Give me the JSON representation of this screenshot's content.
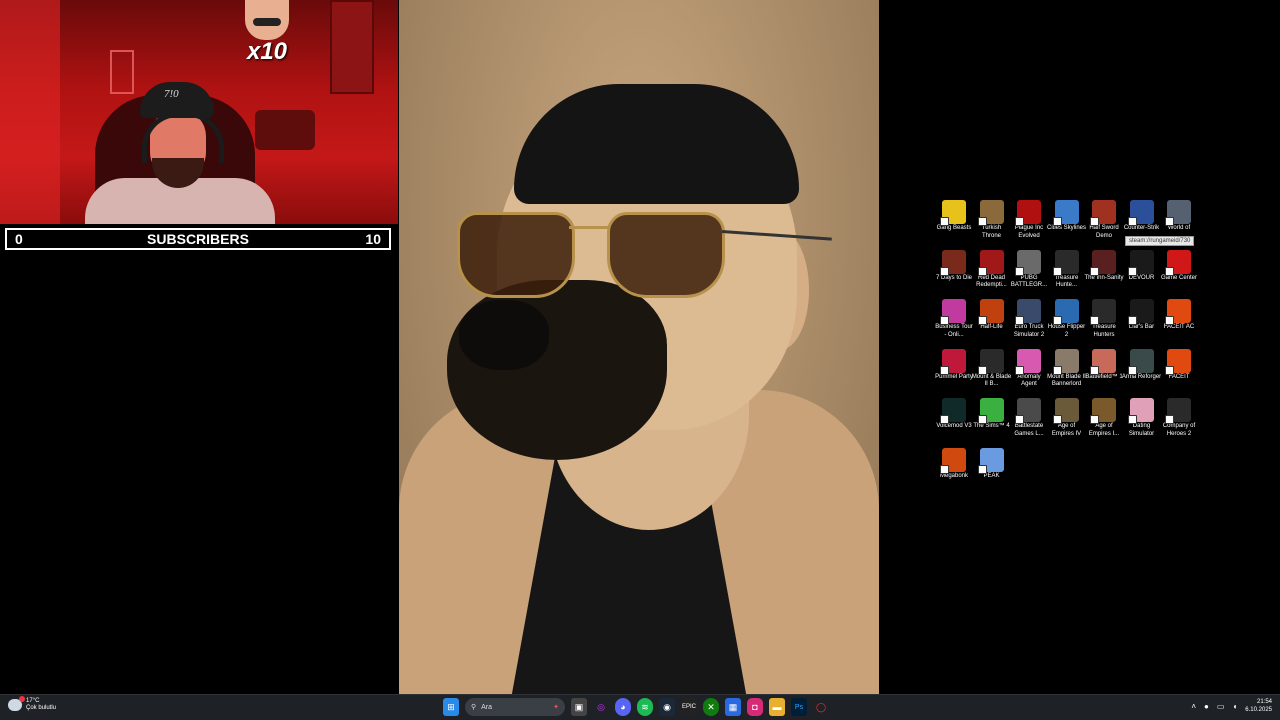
{
  "webcam": {
    "cap_text": "7!0",
    "badge_text": "x10"
  },
  "subscribers": {
    "current": "0",
    "label": "SUBSCRIBERS",
    "goal": "10"
  },
  "desktop_icons": [
    {
      "label": "Gang Beasts",
      "color": "#e6c21a"
    },
    {
      "label": "Turkish Throne",
      "color": "#8a6a3a"
    },
    {
      "label": "Plague Inc Evolved",
      "color": "#b01010"
    },
    {
      "label": "Cities Skylines",
      "color": "#3a7ac8"
    },
    {
      "label": "Half Sword Demo",
      "color": "#a03020"
    },
    {
      "label": "Counter-Strik",
      "color": "#2c4f9a"
    },
    {
      "label": "World of",
      "color": "#556070"
    },
    {
      "label": "7 Days to Die",
      "color": "#7a2a1a"
    },
    {
      "label": "Red Dead Redempti...",
      "color": "#a01818"
    },
    {
      "label": "PUBG BATTLEGR...",
      "color": "#6a6a6a"
    },
    {
      "label": "Treasure Hunte...",
      "color": "#2a2a2a"
    },
    {
      "label": "The Inn-Sanity",
      "color": "#5a2020"
    },
    {
      "label": "DEVOUR",
      "color": "#1a1a1a"
    },
    {
      "label": "Game Center",
      "color": "#d01818"
    },
    {
      "label": "Business Tour - Onli...",
      "color": "#c03aa0"
    },
    {
      "label": "Half-Life",
      "color": "#c04010"
    },
    {
      "label": "Euro Truck Simulator 2",
      "color": "#3a4a6a"
    },
    {
      "label": "House Flipper 2",
      "color": "#2a6ab0"
    },
    {
      "label": "Treasure Hunters",
      "color": "#2a2a2a"
    },
    {
      "label": "Liar's Bar",
      "color": "#1a1a1a"
    },
    {
      "label": "FACEIT AC",
      "color": "#e04a10"
    },
    {
      "label": "Pummel Party",
      "color": "#c0183a"
    },
    {
      "label": "Mount & Blade II B...",
      "color": "#2a2a2a"
    },
    {
      "label": "Anomaly Agent",
      "color": "#d85ab0"
    },
    {
      "label": "Mount Blade II Bannerlord",
      "color": "#8a7a6a"
    },
    {
      "label": "Battlefield™ 1",
      "color": "#c86a5a"
    },
    {
      "label": "Arma Reforger",
      "color": "#3a4a4a"
    },
    {
      "label": "FACEIT",
      "color": "#e04a10"
    },
    {
      "label": "Voicemod V3",
      "color": "#102a2a"
    },
    {
      "label": "The Sims™ 4",
      "color": "#3ab040"
    },
    {
      "label": "Battlestate Games L...",
      "color": "#4a4a4a"
    },
    {
      "label": "Age of Empires IV",
      "color": "#6a5a3a"
    },
    {
      "label": "Age of Empires I...",
      "color": "#7a5a2a"
    },
    {
      "label": "Dating Simulator",
      "color": "#e0a0b8"
    },
    {
      "label": "Company of Heroes 2",
      "color": "#2a2a2a"
    },
    {
      "label": "Megabonk",
      "color": "#d04a10"
    },
    {
      "label": "PEAK",
      "color": "#6a9ae0"
    }
  ],
  "tooltip": "steam://rungameid/730",
  "taskbar": {
    "weather_temp": "17°C",
    "weather_desc": "Çok bulutlu",
    "search_label": "Ara",
    "apps": [
      "start-icon",
      "task-view-icon",
      "app-icon",
      "discord-icon",
      "spotify-icon",
      "steam-icon",
      "epic-icon",
      "xbox-icon",
      "store-icon",
      "instagram-icon",
      "folder-icon",
      "photoshop-icon",
      "opera-icon"
    ],
    "clock_time": "21:54",
    "clock_date": "6.10.2025"
  }
}
